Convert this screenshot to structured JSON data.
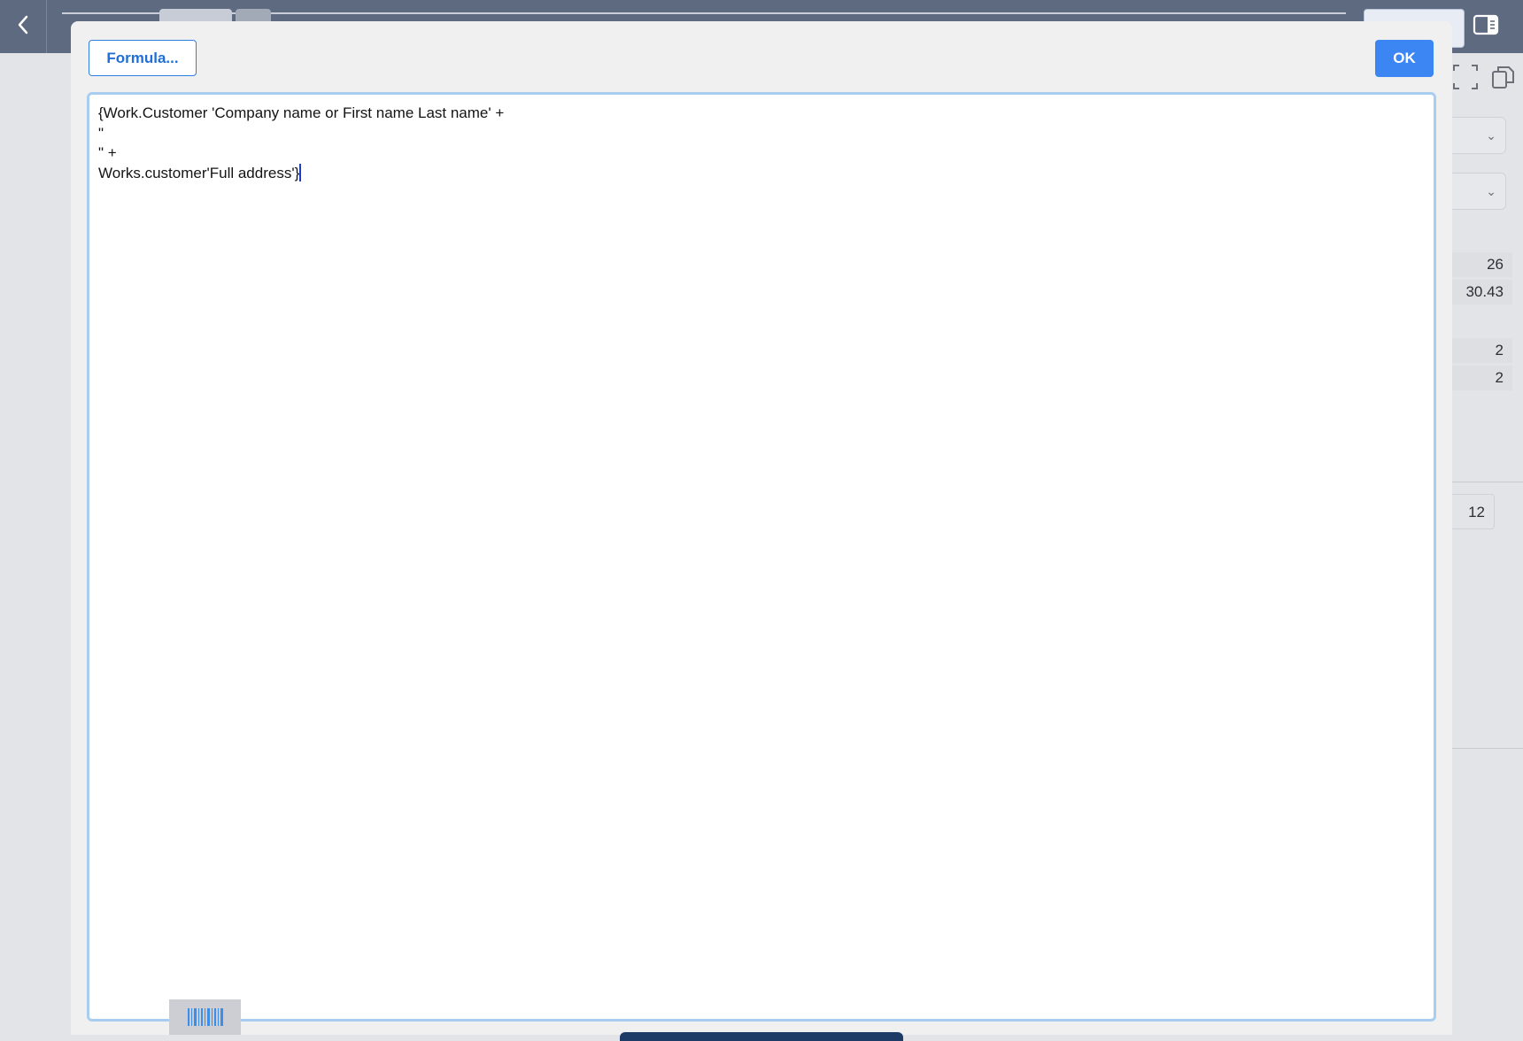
{
  "modal": {
    "formula_button": "Formula...",
    "ok_button": "OK",
    "editor_lines": [
      "{Work.Customer 'Company name or First name Last name' +",
      "\"",
      "\" +",
      "Works.customer'Full address'}"
    ]
  },
  "background_panel": {
    "values": [
      "26",
      "30.43",
      "2",
      "2"
    ],
    "size_box": "12"
  },
  "colors": {
    "topbar": "#5e6a80",
    "accent": "#3b86f3",
    "editor_border": "#a9cdf1"
  },
  "icons": [
    "chevron-left-icon",
    "panel-toggle-icon",
    "fullscreen-icon",
    "copy-icon",
    "chevron-down-icon",
    "barcode-icon"
  ]
}
